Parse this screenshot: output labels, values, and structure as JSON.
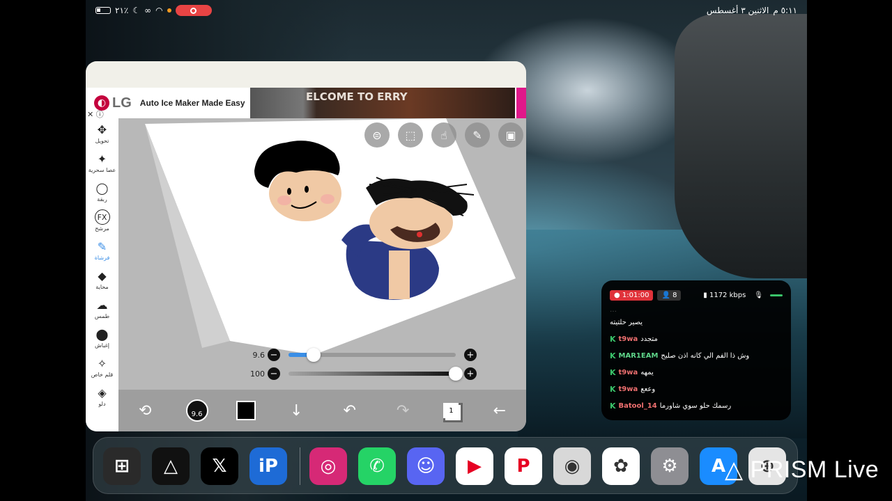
{
  "status_bar": {
    "battery_percent": "٢١٪",
    "time": "٥:١١ م",
    "date": "الاثنين ٣ أغسطس"
  },
  "ad": {
    "brand": "LG",
    "headline": "Auto Ice Maker Made Easy",
    "image_caption": "ELCOME TO ERRY",
    "close_glyph": "✕",
    "info_glyph": "ⓘ"
  },
  "tools": [
    {
      "label": "تحويل",
      "icon": "move-icon",
      "glyph": "✥"
    },
    {
      "label": "عصا سحرية",
      "icon": "magic-wand-icon",
      "glyph": "✦"
    },
    {
      "label": "ربقة",
      "icon": "lasso-icon",
      "glyph": "◯"
    },
    {
      "label": "مرشح",
      "icon": "fx-icon",
      "glyph": "FX"
    },
    {
      "label": "فرشاة",
      "icon": "brush-icon",
      "glyph": "✎"
    },
    {
      "label": "محاية",
      "icon": "eraser-icon",
      "glyph": "◆"
    },
    {
      "label": "طمس",
      "icon": "smudge-icon",
      "glyph": "☁"
    },
    {
      "label": "إغباش",
      "icon": "blur-drop-icon",
      "glyph": "💧"
    },
    {
      "label": "قلم خاص",
      "icon": "special-pen-icon",
      "glyph": "✧"
    },
    {
      "label": "دلو",
      "icon": "bucket-icon",
      "glyph": "◈"
    }
  ],
  "canvas_buttons": [
    {
      "icon": "toggle-icon",
      "glyph": "⊜"
    },
    {
      "icon": "selection-icon",
      "glyph": "⬚"
    },
    {
      "icon": "touch-icon",
      "glyph": "☝"
    },
    {
      "icon": "pen-icon",
      "glyph": "✎"
    },
    {
      "icon": "image-icon",
      "glyph": "🖼"
    }
  ],
  "sliders": {
    "size": {
      "label": "9.6",
      "fraction": 0.15
    },
    "opacity": {
      "label": "100",
      "fraction": 1.0
    },
    "minus": "−",
    "plus": "+"
  },
  "bottom_bar": {
    "brush_size": "9.6",
    "layer_count": "1",
    "down_glyph": "↓",
    "undo_glyph": "↶",
    "redo_glyph": "↷",
    "back_glyph": "←",
    "transform_glyph": "⟲"
  },
  "chat": {
    "timer": "1:01:00",
    "viewers": "8",
    "bitrate": "1172 kbps",
    "messages": [
      {
        "user": "",
        "text": "يصير حلتيته"
      },
      {
        "user": "t9wa",
        "text": "متجدد",
        "color": "red"
      },
      {
        "user": "MAR1EAM",
        "text": "وش ذا الفم الي كانه اذن صليح",
        "color": "green"
      },
      {
        "user": "t9wa",
        "text": "يمهه",
        "color": "red"
      },
      {
        "user": "t9wa",
        "text": "وععع",
        "color": "red"
      },
      {
        "user": "Batool_14",
        "text": "رسمك حلو سوي شاورما",
        "color": "red"
      }
    ]
  },
  "dock": [
    {
      "icon": "app-folder-icon",
      "bg": "#2a2a2a",
      "glyph": "⊞"
    },
    {
      "icon": "prism-icon",
      "bg": "#111111",
      "glyph": "△"
    },
    {
      "icon": "x-icon",
      "bg": "#000000",
      "glyph": "𝕏"
    },
    {
      "icon": "ibispaint-icon",
      "bg": "#1e6bd6",
      "glyph": "iP"
    },
    {
      "icon": "instagram-icon",
      "bg": "#d62976",
      "glyph": "◎"
    },
    {
      "icon": "whatsapp-icon",
      "bg": "#25d366",
      "glyph": "✆"
    },
    {
      "icon": "discord-icon",
      "bg": "#5865f2",
      "glyph": "☺"
    },
    {
      "icon": "youtube-icon",
      "bg": "#ffffff",
      "glyph": "▶"
    },
    {
      "icon": "pinterest-icon",
      "bg": "#ffffff",
      "glyph": "P"
    },
    {
      "icon": "camera-icon",
      "bg": "#d8d8d8",
      "glyph": "◉"
    },
    {
      "icon": "photos-icon",
      "bg": "#ffffff",
      "glyph": "✿"
    },
    {
      "icon": "settings-icon",
      "bg": "#8e8e93",
      "glyph": "⚙"
    },
    {
      "icon": "appstore-icon",
      "bg": "#1a8cff",
      "glyph": "A"
    },
    {
      "icon": "safari-icon",
      "bg": "#e5e5e5",
      "glyph": "⊕"
    }
  ],
  "watermark": "PRISM Live"
}
